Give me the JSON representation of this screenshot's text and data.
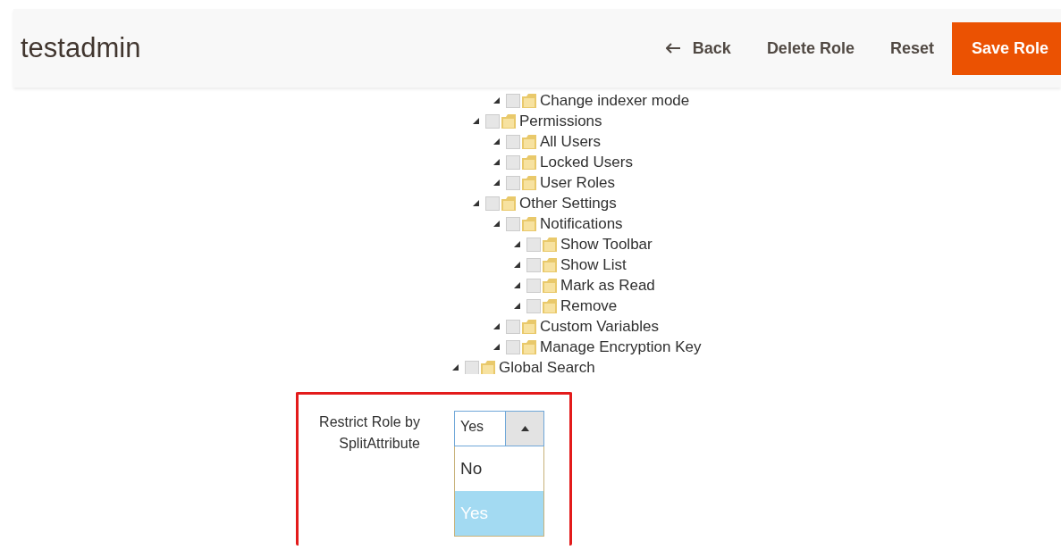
{
  "header": {
    "title": "testadmin",
    "actions": [
      {
        "kind": "back",
        "label": "Back"
      },
      {
        "kind": "plain",
        "label": "Delete Role"
      },
      {
        "kind": "plain",
        "label": "Reset"
      },
      {
        "kind": "primary",
        "label": "Save Role"
      }
    ]
  },
  "tree": [
    {
      "children": [
        {
          "children": [
            {
              "label": "Change indexer mode",
              "checked": false
            }
          ]
        },
        {
          "label": "Permissions",
          "checked": false,
          "children": [
            {
              "label": "All Users",
              "checked": false
            },
            {
              "label": "Locked Users",
              "checked": false
            },
            {
              "label": "User Roles",
              "checked": false
            }
          ]
        },
        {
          "label": "Other Settings",
          "checked": false,
          "children": [
            {
              "label": "Notifications",
              "checked": false,
              "children": [
                {
                  "label": "Show Toolbar",
                  "checked": false
                },
                {
                  "label": "Show List",
                  "checked": false
                },
                {
                  "label": "Mark as Read",
                  "checked": false
                },
                {
                  "label": "Remove",
                  "checked": false
                }
              ]
            },
            {
              "label": "Custom Variables",
              "checked": false
            },
            {
              "label": "Manage Encryption Key",
              "checked": false
            }
          ]
        }
      ]
    },
    {
      "label": "Global Search",
      "checked": false
    }
  ],
  "restrict": {
    "label": "Restrict Role by SplitAttribute",
    "value": "Yes",
    "expanded": true,
    "options": [
      {
        "label": "No",
        "selected": false
      },
      {
        "label": "Yes",
        "selected": true
      }
    ]
  }
}
